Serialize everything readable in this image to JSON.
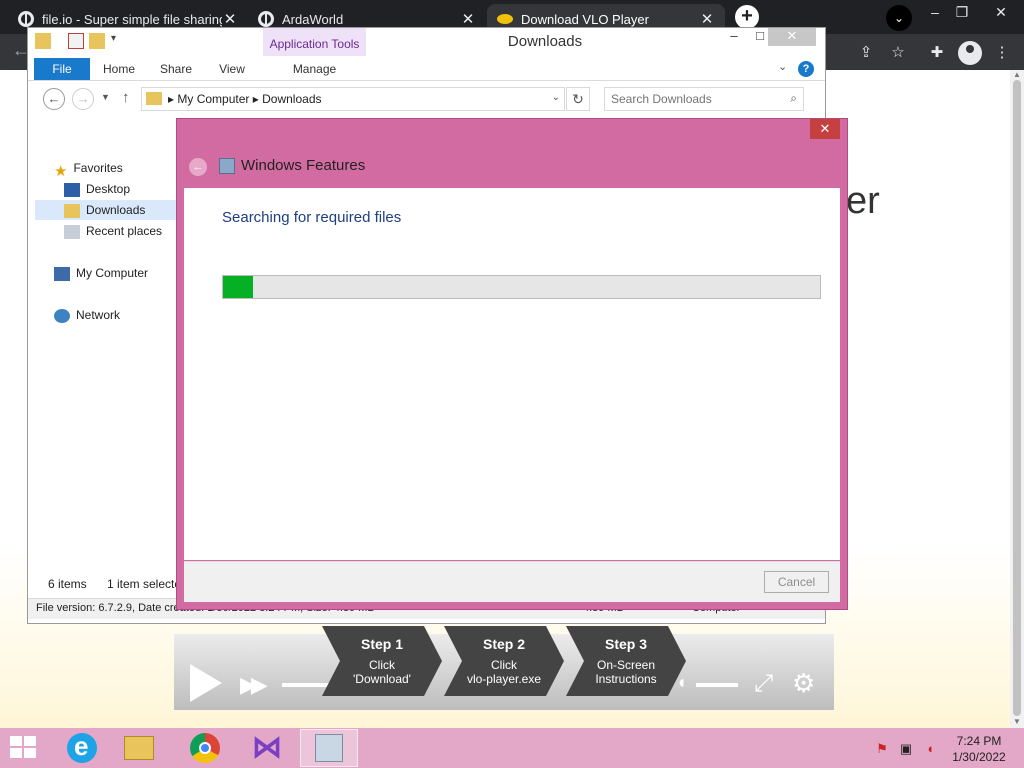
{
  "browser": {
    "tabs": [
      {
        "title": "file.io - Super simple file sharing",
        "close": "✕"
      },
      {
        "title": "ArdaWorld",
        "close": "✕"
      },
      {
        "title": "Download VLO Player",
        "close": "✕"
      }
    ],
    "new_tab": "+",
    "window_controls": {
      "minimize": "–",
      "restore": "❐",
      "close": "✕"
    }
  },
  "page": {
    "heading_fragment": "er",
    "player": {
      "steps": [
        {
          "title": "Step 1",
          "line1": "Click",
          "line2": "'Download'"
        },
        {
          "title": "Step 2",
          "line1": "Click",
          "line2": "vlo-player.exe"
        },
        {
          "title": "Step 3",
          "line1": "On-Screen",
          "line2": "Instructions"
        }
      ]
    }
  },
  "explorer": {
    "title": "Downloads",
    "context_tab_group": "Application Tools",
    "ribbon_tabs": [
      "File",
      "Home",
      "Share",
      "View",
      "Manage"
    ],
    "address": {
      "part1": "My Computer",
      "separator": "▸",
      "part2": "Downloads"
    },
    "search_placeholder": "Search Downloads",
    "nav_pane": {
      "favorites": "Favorites",
      "desktop": "Desktop",
      "downloads": "Downloads",
      "recent": "Recent places",
      "computer": "My Computer",
      "network": "Network"
    },
    "status": {
      "items": "6 items",
      "selected": "1 item selected"
    },
    "details_bar": "File version: 6.7.2.9, Date created: 1/30/2022 3:24 PM, Size: 4.39 MB",
    "details_right_size": "4.39 MB",
    "details_right_location": "Computer"
  },
  "windows_features": {
    "title": "Windows Features",
    "message": "Searching for required files",
    "progress_fraction": 0.05,
    "progress_color": "#06b025",
    "cancel_label": "Cancel",
    "close": "✕"
  },
  "taskbar": {
    "time": "7:24 PM",
    "date": "1/30/2022"
  }
}
